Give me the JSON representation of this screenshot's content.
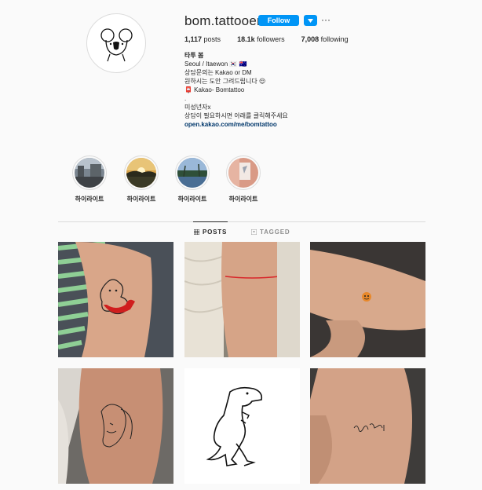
{
  "profile": {
    "username": "bom.tattooer",
    "follow_label": "Follow",
    "more_label": "···",
    "stats": {
      "posts_count": "1,117",
      "posts_label": "posts",
      "followers_count": "18.1k",
      "followers_label": "followers",
      "following_count": "7,008",
      "following_label": "following"
    },
    "bio": {
      "name": "타투 봄",
      "line1": "Seoul / Itaewon 🇰🇷 🇦🇺",
      "line2": "상담문의는 Kakao or DM",
      "line3": "원하시는 도안 그려드립니다 😌",
      "line4": "📮 Kakao- Bomtattoo",
      "line5": ".",
      "line6": "미성년자x",
      "line7": "상담이 필요하시면 아래를 클릭해주세요",
      "link": "open.kakao.com/me/bomtattoo"
    }
  },
  "highlights": [
    {
      "label": "하이라이트",
      "icon": "highlight-thumbnail-street"
    },
    {
      "label": "하이라이트",
      "icon": "highlight-thumbnail-sunset"
    },
    {
      "label": "하이라이트",
      "icon": "highlight-thumbnail-palms"
    },
    {
      "label": "하이라이트",
      "icon": "highlight-thumbnail-tattoo"
    }
  ],
  "tabs": {
    "posts": "POSTS",
    "tagged": "TAGGED"
  },
  "posts": [
    {
      "icon": "tattoo-tiger-photo"
    },
    {
      "icon": "tattoo-red-line-photo"
    },
    {
      "icon": "tattoo-orange-face-photo"
    },
    {
      "icon": "tattoo-face-line-photo"
    },
    {
      "icon": "tattoo-dinosaur-drawing"
    },
    {
      "icon": "tattoo-script-photo"
    }
  ],
  "colors": {
    "accent": "#0095f6",
    "link": "#00376b",
    "text": "#262626",
    "muted": "#8e8e8e",
    "background": "#fafafa"
  }
}
